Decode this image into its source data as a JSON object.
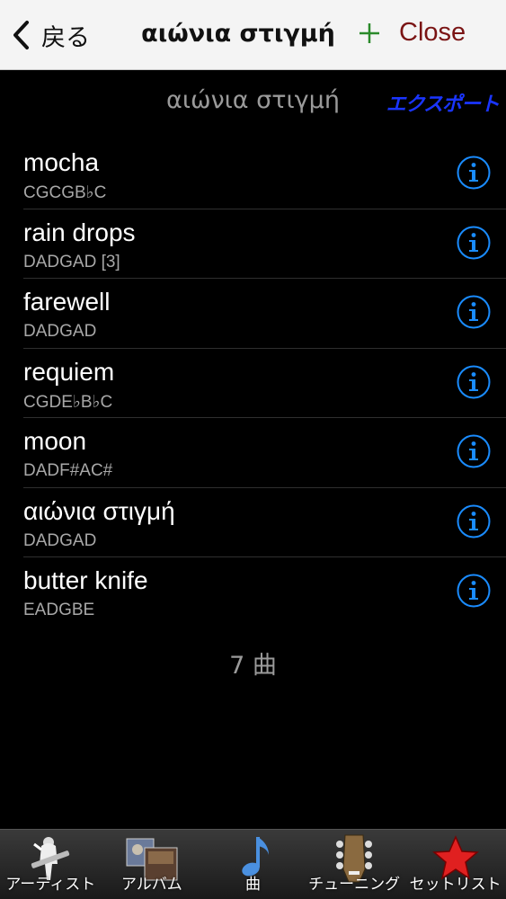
{
  "navbar": {
    "back_label": "戻る",
    "title": "αιώνια στιγμή",
    "close_label": "Close"
  },
  "header": {
    "title": "αιώνια στιγμή",
    "export_label": "エクスポート"
  },
  "songs": [
    {
      "title": "mocha",
      "tuning": "CGCGB♭C"
    },
    {
      "title": "rain drops",
      "tuning": "DADGAD [3]"
    },
    {
      "title": "farewell",
      "tuning": "DADGAD"
    },
    {
      "title": "requiem",
      "tuning": "CGDE♭B♭C"
    },
    {
      "title": "moon",
      "tuning": "DADF#AC#"
    },
    {
      "title": "αιώνια στιγμή",
      "tuning": "DADGAD"
    },
    {
      "title": "butter knife",
      "tuning": "EADGBE"
    }
  ],
  "song_count": "7 曲",
  "tabs": [
    {
      "label": "アーティスト",
      "icon": "artist-icon",
      "active": true
    },
    {
      "label": "アルバム",
      "icon": "album-icon",
      "active": false
    },
    {
      "label": "曲",
      "icon": "music-note-icon",
      "active": false
    },
    {
      "label": "チューニング",
      "icon": "guitar-headstock-icon",
      "active": false
    },
    {
      "label": "セットリスト",
      "icon": "star-icon",
      "active": false
    }
  ],
  "colors": {
    "background": "#000000",
    "navbar": "#f4f4f4",
    "accent_blue": "#1a8cff",
    "export_blue": "#1a35ff",
    "close_red": "#7a1414",
    "active_tab": "#1a3fc8"
  }
}
